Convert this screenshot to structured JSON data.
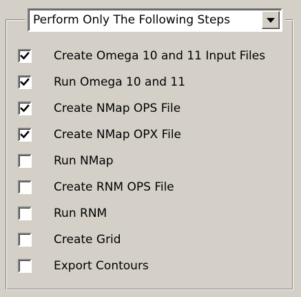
{
  "dropdown": {
    "selected": "Perform Only The Following Steps"
  },
  "steps": [
    {
      "label": "Create Omega 10 and 11 Input Files",
      "checked": true
    },
    {
      "label": "Run Omega 10 and 11",
      "checked": true
    },
    {
      "label": "Create NMap OPS File",
      "checked": true
    },
    {
      "label": "Create NMap OPX File",
      "checked": true
    },
    {
      "label": "Run NMap",
      "checked": false
    },
    {
      "label": "Create RNM OPS File",
      "checked": false
    },
    {
      "label": "Run RNM",
      "checked": false
    },
    {
      "label": "Create Grid",
      "checked": false
    },
    {
      "label": "Export Contours",
      "checked": false
    }
  ]
}
